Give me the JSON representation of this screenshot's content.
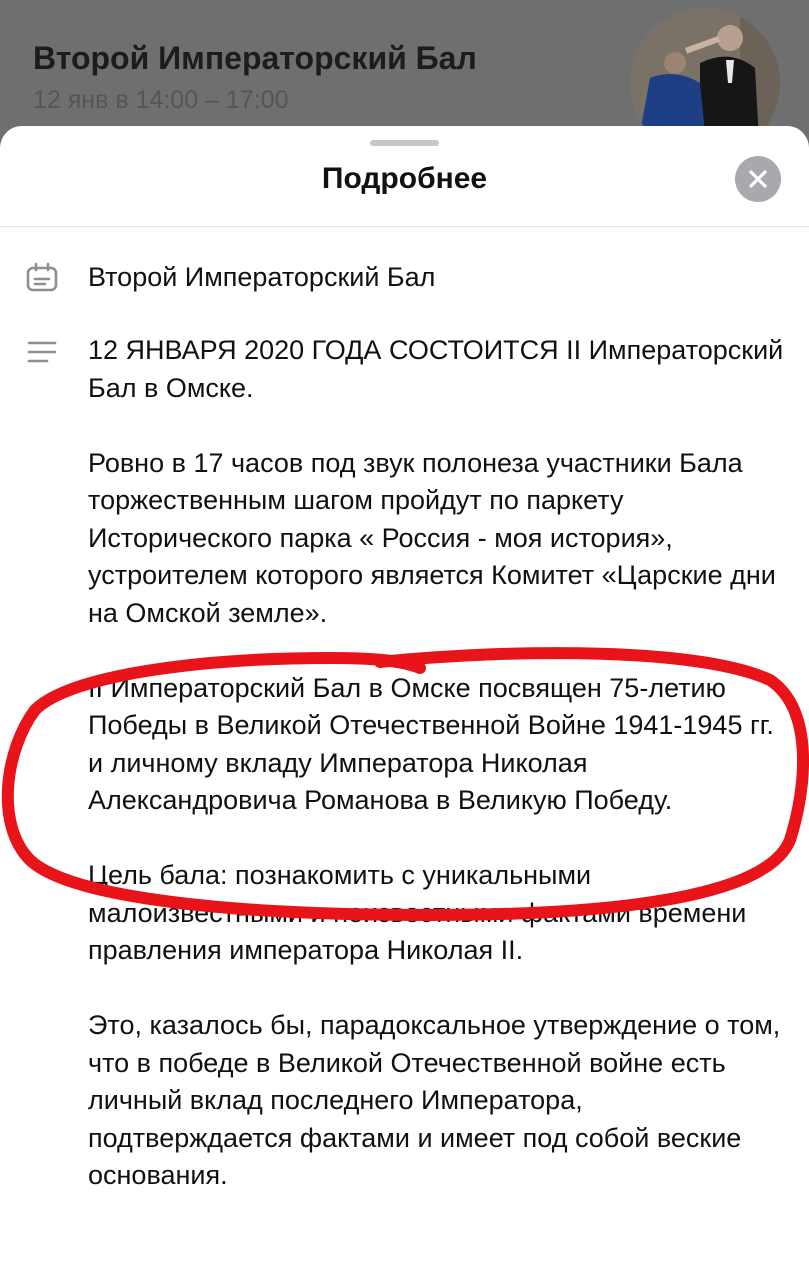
{
  "header": {
    "title": "Второй Императорский Бал",
    "date": "12 янв в 14:00 – 17:00"
  },
  "sheet": {
    "title": "Подробнее"
  },
  "event": {
    "name": "Второй Императорский Бал"
  },
  "description": {
    "paragraphs": [
      "12 ЯНВАРЯ 2020 ГОДА СОСТОИТСЯ II Императорский Бал в Омске.",
      "Ровно в 17 часов под звук полонеза участники Бала торжественным шагом пройдут по паркету Исторического парка « Россия - моя история», устроителем которого является  Комитет «Царские дни на Омской земле».",
      "II Императорский Бал в Омске посвящен 75-летию Победы в Великой Отечественной Войне 1941-1945 гг. и личному вкладу Императора Николая Александровича Романова в Великую Победу.",
      "Цель бала: познакомить с уникальными малоизвестными и неизвестными фактами времени правления императора Николая II.",
      "Это, казалось бы, парадоксальное утверждение о том, что в победе в Великой Отечественной войне есть личный вклад последнего Императора, подтверждается фактами и имеет под собой веские основания."
    ]
  },
  "icons": {
    "name_row": "calendar-event-icon",
    "description_row": "text-lines-icon",
    "close": "close-icon"
  },
  "colors": {
    "highlight": "#e8141a",
    "close_bg": "#a9a9ad",
    "icon": "#8e8e93"
  }
}
